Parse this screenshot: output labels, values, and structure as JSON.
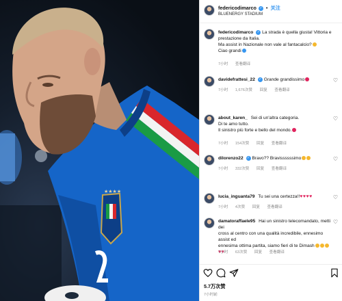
{
  "post": {
    "username": "federicodimarco",
    "follow_label": "关注",
    "location": "BLUENERGY STADIUM",
    "caption_user": "federicodimarco",
    "caption_lines": [
      "La strada è quella giusta! Vittoria e",
      "prestazione da Italia.",
      "Ma assist in Nazionale non vale al fantacalcio?",
      "Ciao grandi"
    ],
    "caption_time": "7小时",
    "translate_label": "查看翻译",
    "likes": "5.7万次赞",
    "time_ago": "7小时前"
  },
  "comments": [
    {
      "user": "davidefrattesi_22",
      "lines": [
        "Grande grandissimo"
      ],
      "time": "7小时",
      "likes": "1,676次赞",
      "reply": "回复",
      "translate": "查看翻译"
    },
    {
      "user": "about_karen_",
      "lines": [
        "Sei di un'altra categoria.",
        "Di te amo tutto.",
        "Il sinistro più forte e bello del mondo."
      ],
      "time": "7小时",
      "likes": "154次赞",
      "reply": "回复",
      "translate": "查看翻译"
    },
    {
      "user": "dilorenzo22",
      "lines": [
        "Bravo?? Bravissssssimo"
      ],
      "time": "7小时",
      "likes": "332次赞",
      "reply": "回复",
      "translate": "查看翻译"
    },
    {
      "user": "lucia_inguanta79",
      "lines": [
        "Tu sei una certezza!!"
      ],
      "time": "7小时",
      "likes": "4次赞",
      "reply": "回复",
      "translate": "查看翻译"
    },
    {
      "user": "damatoraffaele95",
      "lines": [
        "Hai un sinistro telecomandato, metti dei",
        "cross al centro con una qualità incredibile, ennesimo assist ed",
        "ennesima ottima partita, siamo fieri di te Dimash"
      ],
      "time": "7小时",
      "likes": "63次赞",
      "reply": "回复",
      "translate": "查看翻译"
    }
  ],
  "icons": {
    "like": "heart-icon",
    "comment": "comment-bubble-icon",
    "share": "paper-plane-icon",
    "save": "bookmark-icon",
    "verified": "verified-badge-icon"
  },
  "colors": {
    "accent": "#3897f0",
    "heart": "#e0245e",
    "jersey": "#1e6fd6",
    "muted": "#8e8e8e"
  }
}
